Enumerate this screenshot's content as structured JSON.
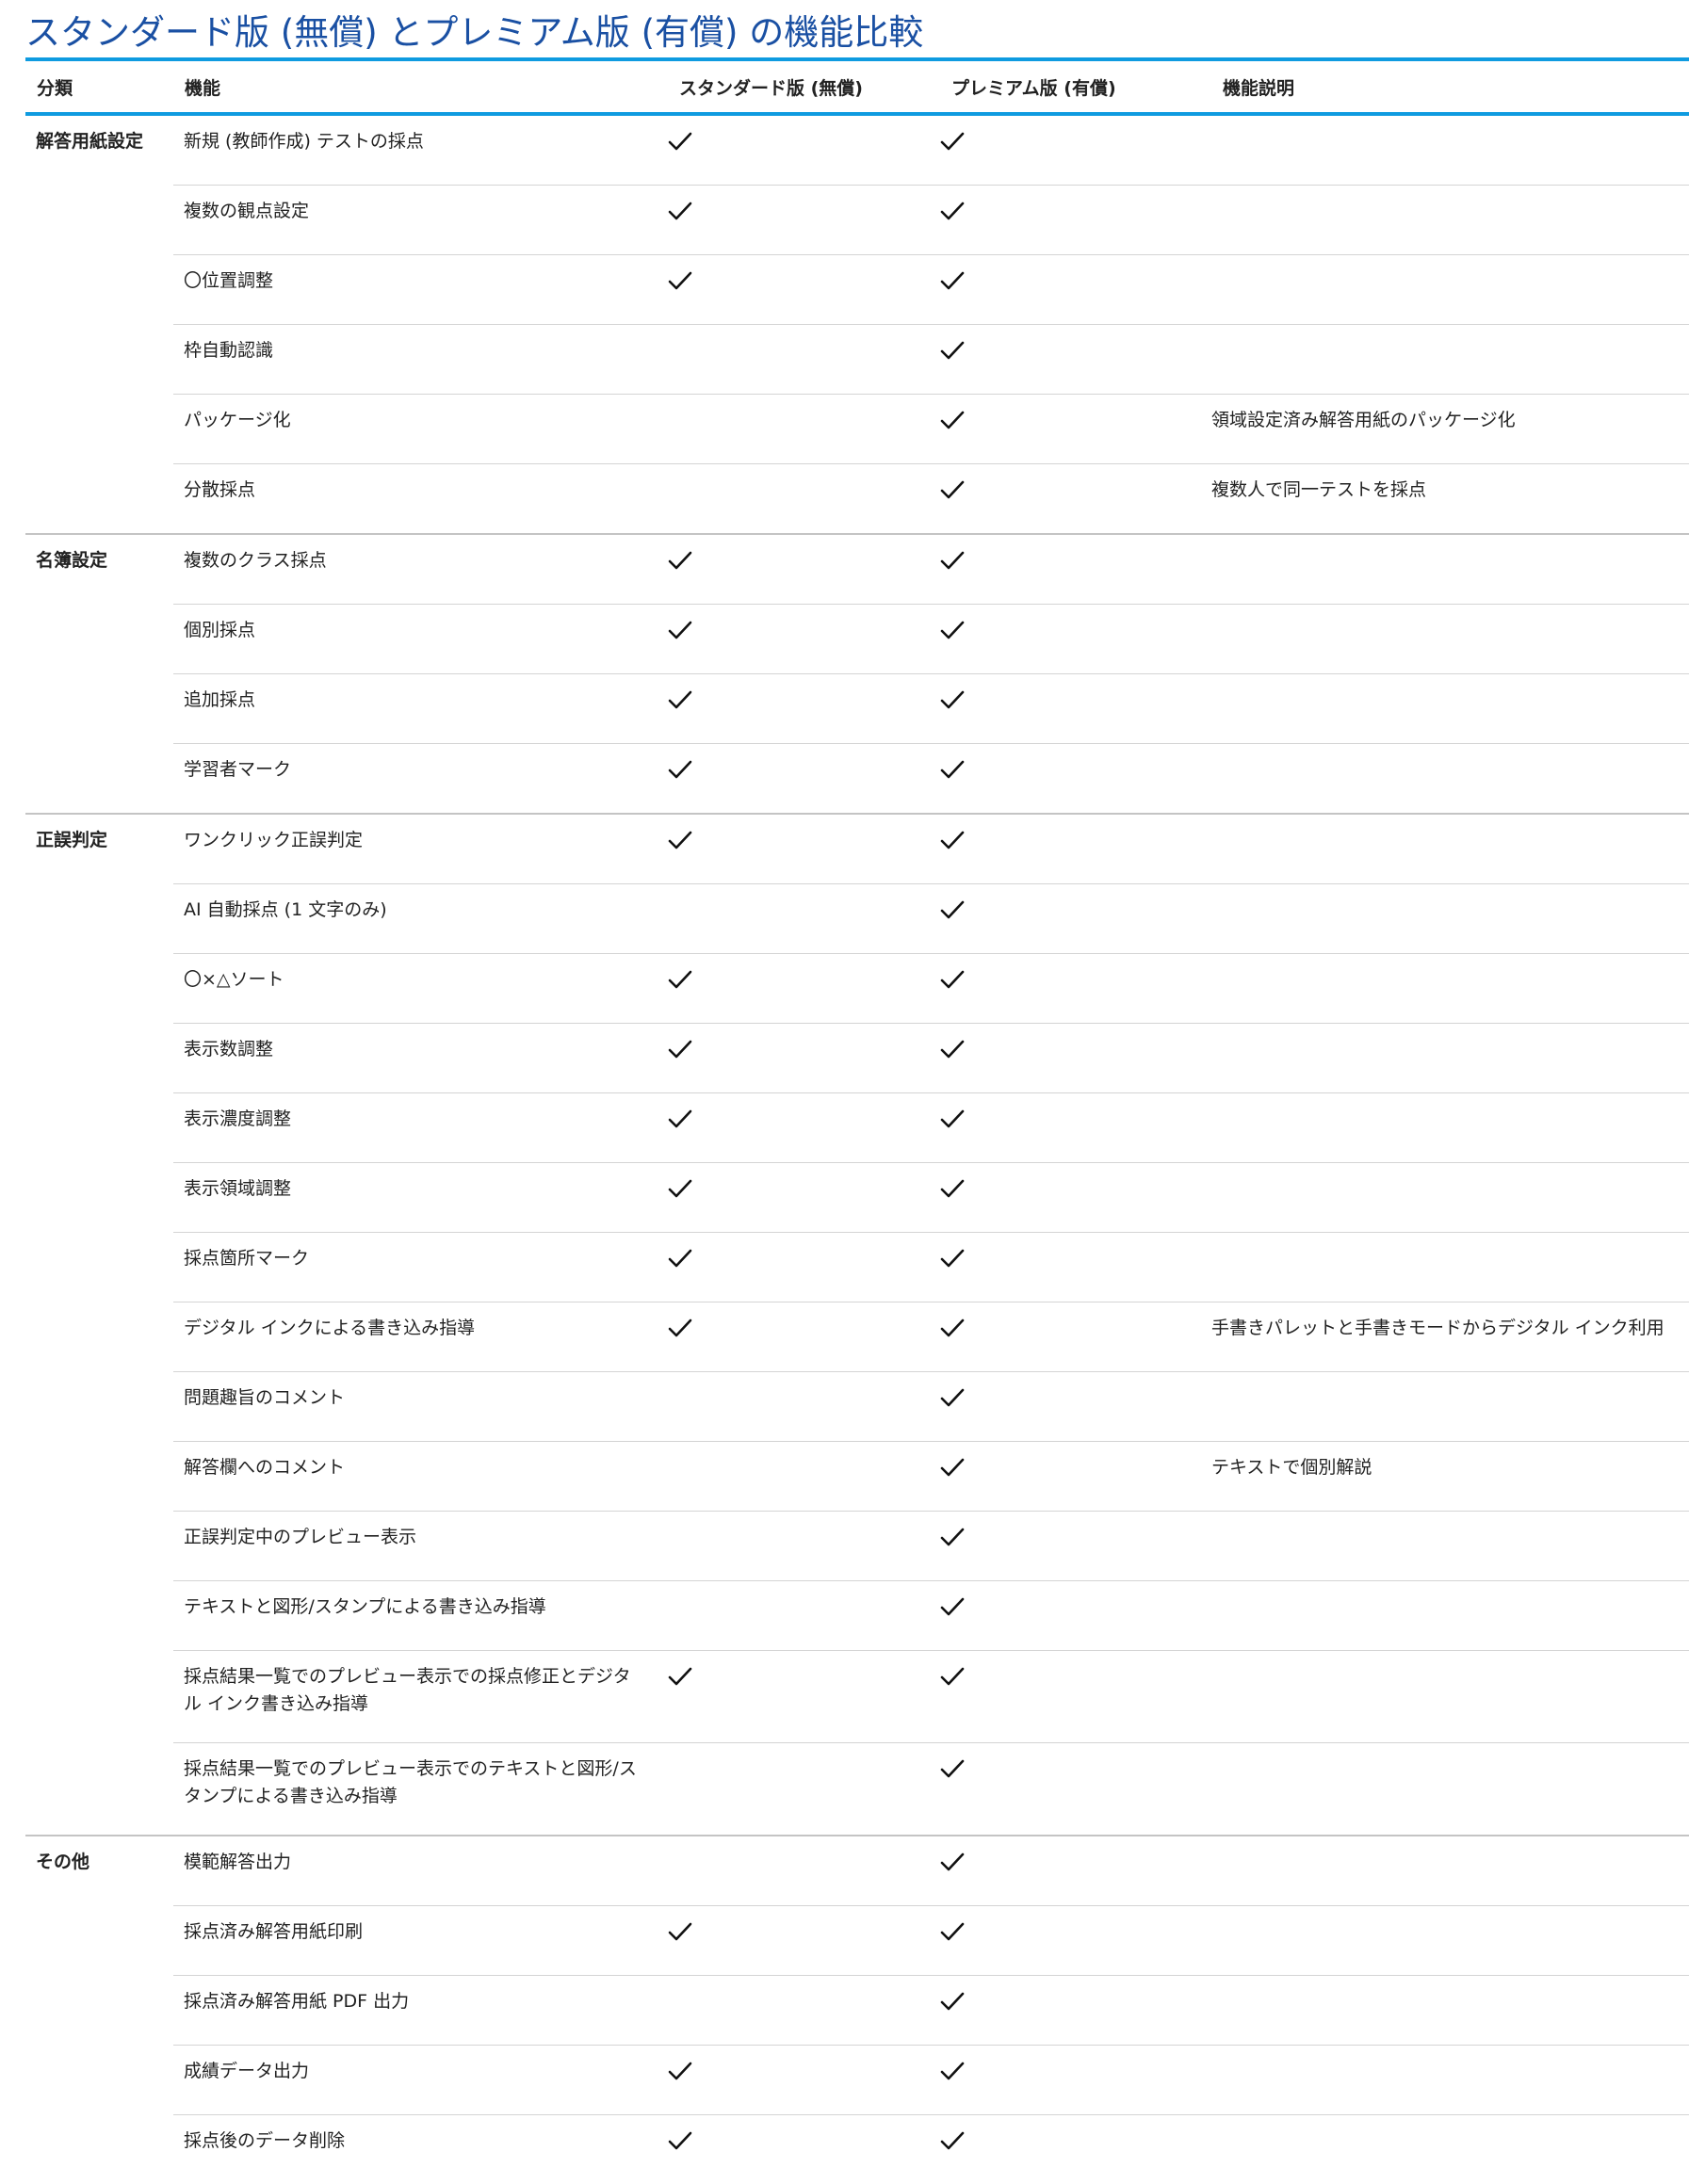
{
  "title": "スタンダード版 (無償) とプレミアム版 (有償) の機能比較",
  "columns": {
    "category": "分類",
    "feature": "機能",
    "standard": "スタンダード版 (無償)",
    "premium": "プレミアム版 (有償)",
    "description": "機能説明"
  },
  "icons": {
    "check": "check-icon"
  },
  "colors": {
    "title": "#1a50a3",
    "accent_rule": "#0f9be0"
  },
  "groups": [
    {
      "category": "解答用紙設定",
      "features": [
        {
          "name": "新規 (教師作成) テストの採点",
          "standard": true,
          "premium": true,
          "description": ""
        },
        {
          "name": "複数の観点設定",
          "standard": true,
          "premium": true,
          "description": ""
        },
        {
          "name": "〇位置調整",
          "standard": true,
          "premium": true,
          "description": ""
        },
        {
          "name": "枠自動認識",
          "standard": false,
          "premium": true,
          "description": ""
        },
        {
          "name": "パッケージ化",
          "standard": false,
          "premium": true,
          "description": "領域設定済み解答用紙のパッケージ化"
        },
        {
          "name": "分散採点",
          "standard": false,
          "premium": true,
          "description": "複数人で同一テストを採点"
        }
      ]
    },
    {
      "category": "名簿設定",
      "features": [
        {
          "name": "複数のクラス採点",
          "standard": true,
          "premium": true,
          "description": ""
        },
        {
          "name": "個別採点",
          "standard": true,
          "premium": true,
          "description": ""
        },
        {
          "name": "追加採点",
          "standard": true,
          "premium": true,
          "description": ""
        },
        {
          "name": "学習者マーク",
          "standard": true,
          "premium": true,
          "description": ""
        }
      ]
    },
    {
      "category": "正誤判定",
      "features": [
        {
          "name": "ワンクリック正誤判定",
          "standard": true,
          "premium": true,
          "description": ""
        },
        {
          "name": "AI 自動採点 (1 文字のみ)",
          "standard": false,
          "premium": true,
          "description": ""
        },
        {
          "name": "〇×△ソート",
          "standard": true,
          "premium": true,
          "description": ""
        },
        {
          "name": "表示数調整",
          "standard": true,
          "premium": true,
          "description": ""
        },
        {
          "name": "表示濃度調整",
          "standard": true,
          "premium": true,
          "description": ""
        },
        {
          "name": "表示領域調整",
          "standard": true,
          "premium": true,
          "description": ""
        },
        {
          "name": "採点箇所マーク",
          "standard": true,
          "premium": true,
          "description": ""
        },
        {
          "name": "デジタル インクによる書き込み指導",
          "standard": true,
          "premium": true,
          "description": "手書きパレットと手書きモードからデジタル インク利用"
        },
        {
          "name": "問題趣旨のコメント",
          "standard": false,
          "premium": true,
          "description": ""
        },
        {
          "name": "解答欄へのコメント",
          "standard": false,
          "premium": true,
          "description": "テキストで個別解説"
        },
        {
          "name": "正誤判定中のプレビュー表示",
          "standard": false,
          "premium": true,
          "description": ""
        },
        {
          "name": "テキストと図形/スタンプによる書き込み指導",
          "standard": false,
          "premium": true,
          "description": ""
        },
        {
          "name": "採点結果一覧でのプレビュー表示での採点修正とデジタル インク書き込み指導",
          "standard": true,
          "premium": true,
          "description": ""
        },
        {
          "name": "採点結果一覧でのプレビュー表示でのテキストと図形/スタンプによる書き込み指導",
          "standard": false,
          "premium": true,
          "description": ""
        }
      ]
    },
    {
      "category": "その他",
      "features": [
        {
          "name": "模範解答出力",
          "standard": false,
          "premium": true,
          "description": ""
        },
        {
          "name": "採点済み解答用紙印刷",
          "standard": true,
          "premium": true,
          "description": ""
        },
        {
          "name": "採点済み解答用紙 PDF 出力",
          "standard": false,
          "premium": true,
          "description": ""
        },
        {
          "name": "成績データ出力",
          "standard": true,
          "premium": true,
          "description": ""
        },
        {
          "name": "採点後のデータ削除",
          "standard": true,
          "premium": true,
          "description": ""
        }
      ]
    }
  ]
}
